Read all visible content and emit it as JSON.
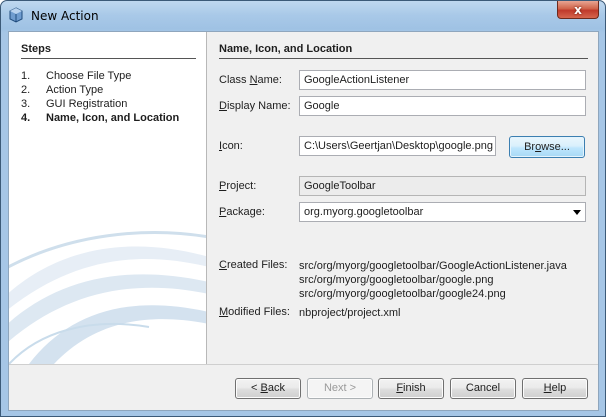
{
  "window": {
    "title": "New Action",
    "close_glyph": "x"
  },
  "steps": {
    "title": "Steps",
    "items": [
      {
        "num": "1.",
        "label": "Choose File Type"
      },
      {
        "num": "2.",
        "label": "Action Type"
      },
      {
        "num": "3.",
        "label": "GUI Registration"
      },
      {
        "num": "4.",
        "label": "Name, Icon, and Location"
      }
    ],
    "current_index": 3
  },
  "form": {
    "section_title": "Name, Icon, and Location",
    "class_name": {
      "label_pre": "Class ",
      "label_mn": "N",
      "label_post": "ame:",
      "value": "GoogleActionListener"
    },
    "display_name": {
      "label_pre": "",
      "label_mn": "D",
      "label_post": "isplay Name:",
      "value": "Google"
    },
    "icon": {
      "label_pre": "",
      "label_mn": "I",
      "label_post": "con:",
      "value": "C:\\Users\\Geertjan\\Desktop\\google.png"
    },
    "browse_button": {
      "pre": "Br",
      "mn": "o",
      "post": "wse..."
    },
    "project": {
      "label_pre": "",
      "label_mn": "P",
      "label_post": "roject:",
      "value": "GoogleToolbar"
    },
    "package": {
      "label_pre": "",
      "label_mn": "P",
      "label_post": "ackage:",
      "value": "org.myorg.googletoolbar"
    },
    "created_files": {
      "label_pre": "",
      "label_mn": "C",
      "label_post": "reated Files:",
      "files": [
        "src/org/myorg/googletoolbar/GoogleActionListener.java",
        "src/org/myorg/googletoolbar/google.png",
        "src/org/myorg/googletoolbar/google24.png"
      ]
    },
    "modified_files": {
      "label_pre": "",
      "label_mn": "M",
      "label_post": "odified Files:",
      "files": [
        "nbproject/project.xml"
      ]
    }
  },
  "buttons": {
    "back": {
      "pre": "< ",
      "mn": "B",
      "post": "ack"
    },
    "next": {
      "pre": "Next >",
      "mn": "",
      "post": ""
    },
    "finish": {
      "pre": "",
      "mn": "F",
      "post": "inish"
    },
    "cancel": {
      "pre": "Cancel",
      "mn": "",
      "post": ""
    },
    "help": {
      "pre": "",
      "mn": "H",
      "post": "elp"
    }
  },
  "colors": {
    "titlebar": "#a9c9e8",
    "close_button": "#c0392b",
    "default_button_border": "#3c7fb1",
    "swoosh": "#c9dceb"
  },
  "icons": {
    "app": "netbeans-cube-icon",
    "close": "close-icon",
    "dropdown": "chevron-down-icon"
  }
}
